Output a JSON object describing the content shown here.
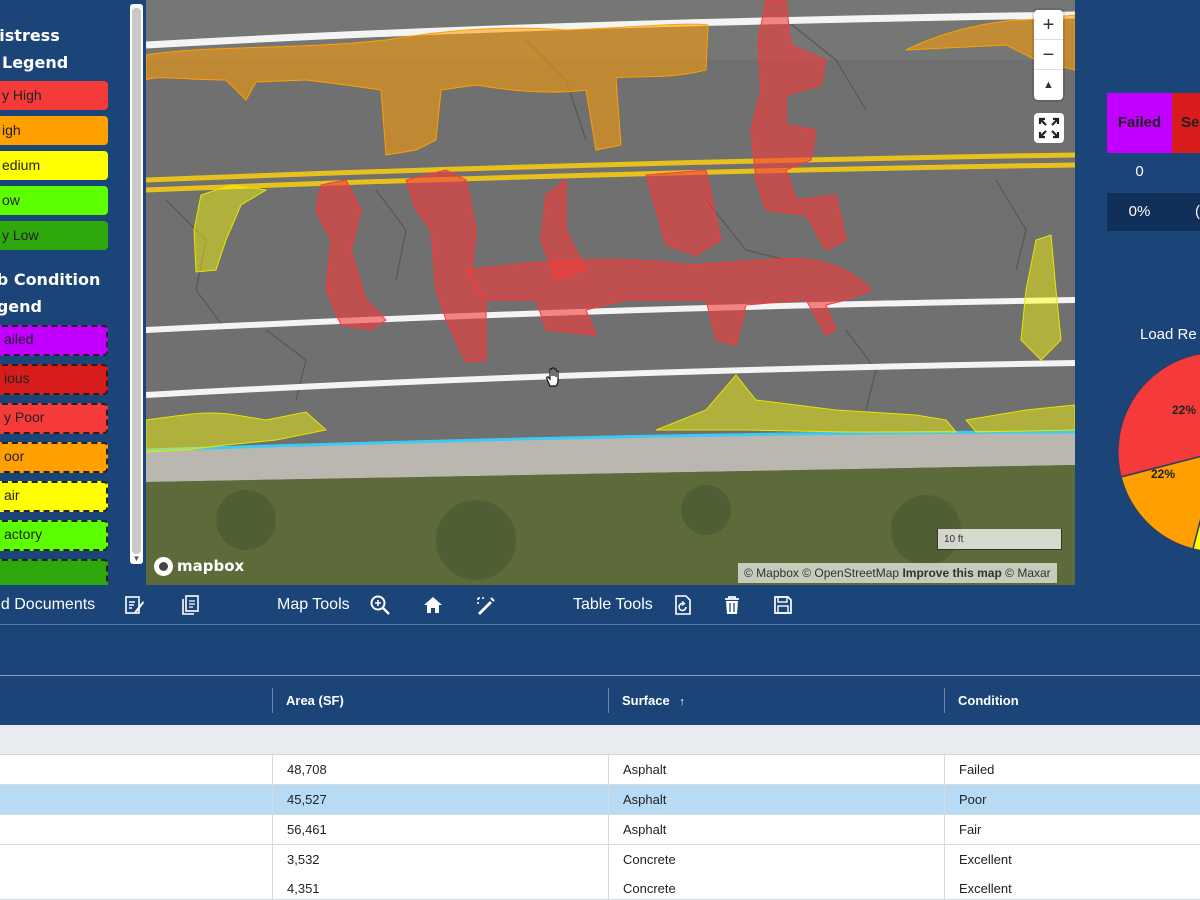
{
  "legend": {
    "distress_title_1": "Distress",
    "distress_title_2": "y Legend",
    "distress_items": [
      {
        "label": "y High",
        "color": "#f53a3a"
      },
      {
        "label": "igh",
        "color": "#ff9f00"
      },
      {
        "label": "edium",
        "color": "#ffff00"
      },
      {
        "label": "ow",
        "color": "#5cff00"
      },
      {
        "label": "y Low",
        "color": "#2ea80c"
      }
    ],
    "slab_title_1": "ab Condition",
    "slab_title_2": "egend",
    "slab_items": [
      {
        "label": "ailed",
        "color": "#c100ff"
      },
      {
        "label": "ious",
        "color": "#d81c1c"
      },
      {
        "label": "y Poor",
        "color": "#f53a3a"
      },
      {
        "label": "oor",
        "color": "#ff9f00"
      },
      {
        "label": "air",
        "color": "#ffff00"
      },
      {
        "label": "actory",
        "color": "#5cff00"
      }
    ]
  },
  "map": {
    "zoom_in": "+",
    "zoom_out": "−",
    "compass": "▲",
    "scale": "10 ft",
    "logo": "mapbox",
    "attribution_1": "© Mapbox © OpenStreetMap",
    "attribution_improve": "Improve this map",
    "attribution_2": "© Maxar"
  },
  "stats": {
    "failed_label": "Failed",
    "serious_label": "Se",
    "failed_count": "0",
    "failed_pct": "0%",
    "next_pct": "(",
    "load_title": "Load Re",
    "pie_labels": [
      "22%",
      "22%"
    ]
  },
  "toolbar": {
    "documents_label": "nd Documents",
    "map_tools_label": "Map Tools",
    "table_tools_label": "Table Tools"
  },
  "table": {
    "columns": [
      "Area (SF)",
      "Surface",
      "Condition"
    ],
    "sort_icon": "↑",
    "rows": [
      {
        "area": "48,708",
        "surface": "Asphalt",
        "condition": "Failed"
      },
      {
        "area": "45,527",
        "surface": "Asphalt",
        "condition": "Poor"
      },
      {
        "area": "56,461",
        "surface": "Asphalt",
        "condition": "Fair"
      },
      {
        "area": "3,532",
        "surface": "Concrete",
        "condition": "Excellent"
      },
      {
        "area": "4,351",
        "surface": "Concrete",
        "condition": "Excellent"
      }
    ]
  },
  "colors": {
    "panel_bg": "#1b4478",
    "selected_row": "#b8dbf5",
    "distress_red": "#f53a3a",
    "distress_orange": "#ff9f00",
    "distress_yellow": "#ffff00"
  }
}
